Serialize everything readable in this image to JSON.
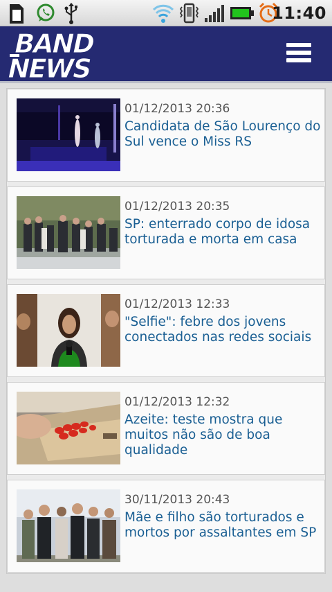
{
  "statusbar": {
    "time": "11:40",
    "icons": [
      "sim-card-icon",
      "whatsapp-icon",
      "usb-icon",
      "wifi-icon",
      "vibrate-icon",
      "signal-icon",
      "battery-icon",
      "alarm-icon"
    ]
  },
  "header": {
    "logo_line1": "BAND",
    "logo_line2": "NEWS",
    "menu_icon": "hamburger-menu-icon"
  },
  "colors": {
    "header_bg": "#252a72",
    "title_text": "#1a5f93",
    "date_text": "#555555"
  },
  "news": [
    {
      "date": "01/12/2013 20:36",
      "title": "Candidata de São Lourenço do Sul vence o Miss RS"
    },
    {
      "date": "01/12/2013 20:35",
      "title": "SP: enterrado corpo de idosa torturada e morta em casa"
    },
    {
      "date": "01/12/2013 12:33",
      "title": "\"Selfie\": febre dos jovens conectados nas redes sociais"
    },
    {
      "date": "01/12/2013 12:32",
      "title": "Azeite: teste mostra que muitos não são de boa qualidade"
    },
    {
      "date": "30/11/2013 20:43",
      "title": "Mãe e filho são torturados e mortos por assaltantes em SP"
    }
  ]
}
